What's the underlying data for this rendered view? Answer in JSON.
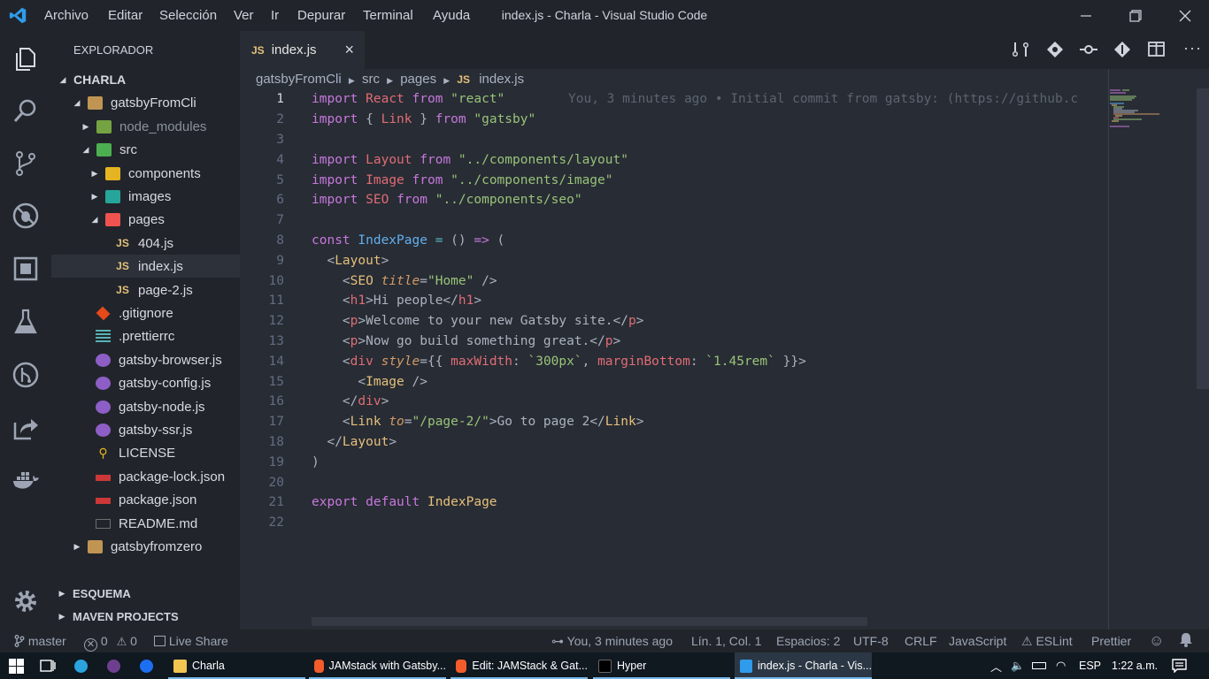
{
  "titlebar": {
    "menu": [
      "Archivo",
      "Editar",
      "Selección",
      "Ver",
      "Ir",
      "Depurar",
      "Terminal",
      "Ayuda"
    ],
    "title": "index.js - Charla - Visual Studio Code"
  },
  "sidebar": {
    "header": "EXPLORADOR",
    "workspace": "CHARLA",
    "tree": [
      {
        "label": "gatsbyFromCli"
      },
      {
        "label": "node_modules"
      },
      {
        "label": "src"
      },
      {
        "label": "components"
      },
      {
        "label": "images"
      },
      {
        "label": "pages"
      },
      {
        "label": "404.js"
      },
      {
        "label": "index.js"
      },
      {
        "label": "page-2.js"
      },
      {
        "label": ".gitignore"
      },
      {
        "label": ".prettierrc"
      },
      {
        "label": "gatsby-browser.js"
      },
      {
        "label": "gatsby-config.js"
      },
      {
        "label": "gatsby-node.js"
      },
      {
        "label": "gatsby-ssr.js"
      },
      {
        "label": "LICENSE"
      },
      {
        "label": "package-lock.json"
      },
      {
        "label": "package.json"
      },
      {
        "label": "README.md"
      },
      {
        "label": "gatsbyfromzero"
      }
    ],
    "sections": [
      "ESQUEMA",
      "MAVEN PROJECTS"
    ]
  },
  "tab": {
    "icon": "JS",
    "label": "index.js",
    "close": "×"
  },
  "breadcrumb": [
    "gatsbyFromCli",
    "src",
    "pages",
    "JS",
    "index.js"
  ],
  "editor": {
    "line_numbers": [
      "1",
      "2",
      "3",
      "4",
      "5",
      "6",
      "7",
      "8",
      "9",
      "10",
      "11",
      "12",
      "13",
      "14",
      "15",
      "16",
      "17",
      "18",
      "19",
      "20",
      "21",
      "22"
    ],
    "blame": "You, 3 minutes ago • Initial commit from gatsby: (https://github.c"
  },
  "status": {
    "branch": "master",
    "errors": "0",
    "warnings": "0",
    "live_share": "Live Share",
    "blame": "You, 3 minutes ago",
    "position": "Lín. 1, Col. 1",
    "spaces": "Espacios: 2",
    "encoding": "UTF-8",
    "eol": "CRLF",
    "language": "JavaScript",
    "eslint": "ESLint",
    "prettier": "Prettier"
  },
  "taskbar": {
    "tasks": [
      "Charla",
      "JAMstack with Gatsby...",
      "Edit: JAMStack & Gat...",
      "Hyper",
      "index.js - Charla - Vis..."
    ],
    "lang": "ESP",
    "time": "1:22 a.m."
  }
}
